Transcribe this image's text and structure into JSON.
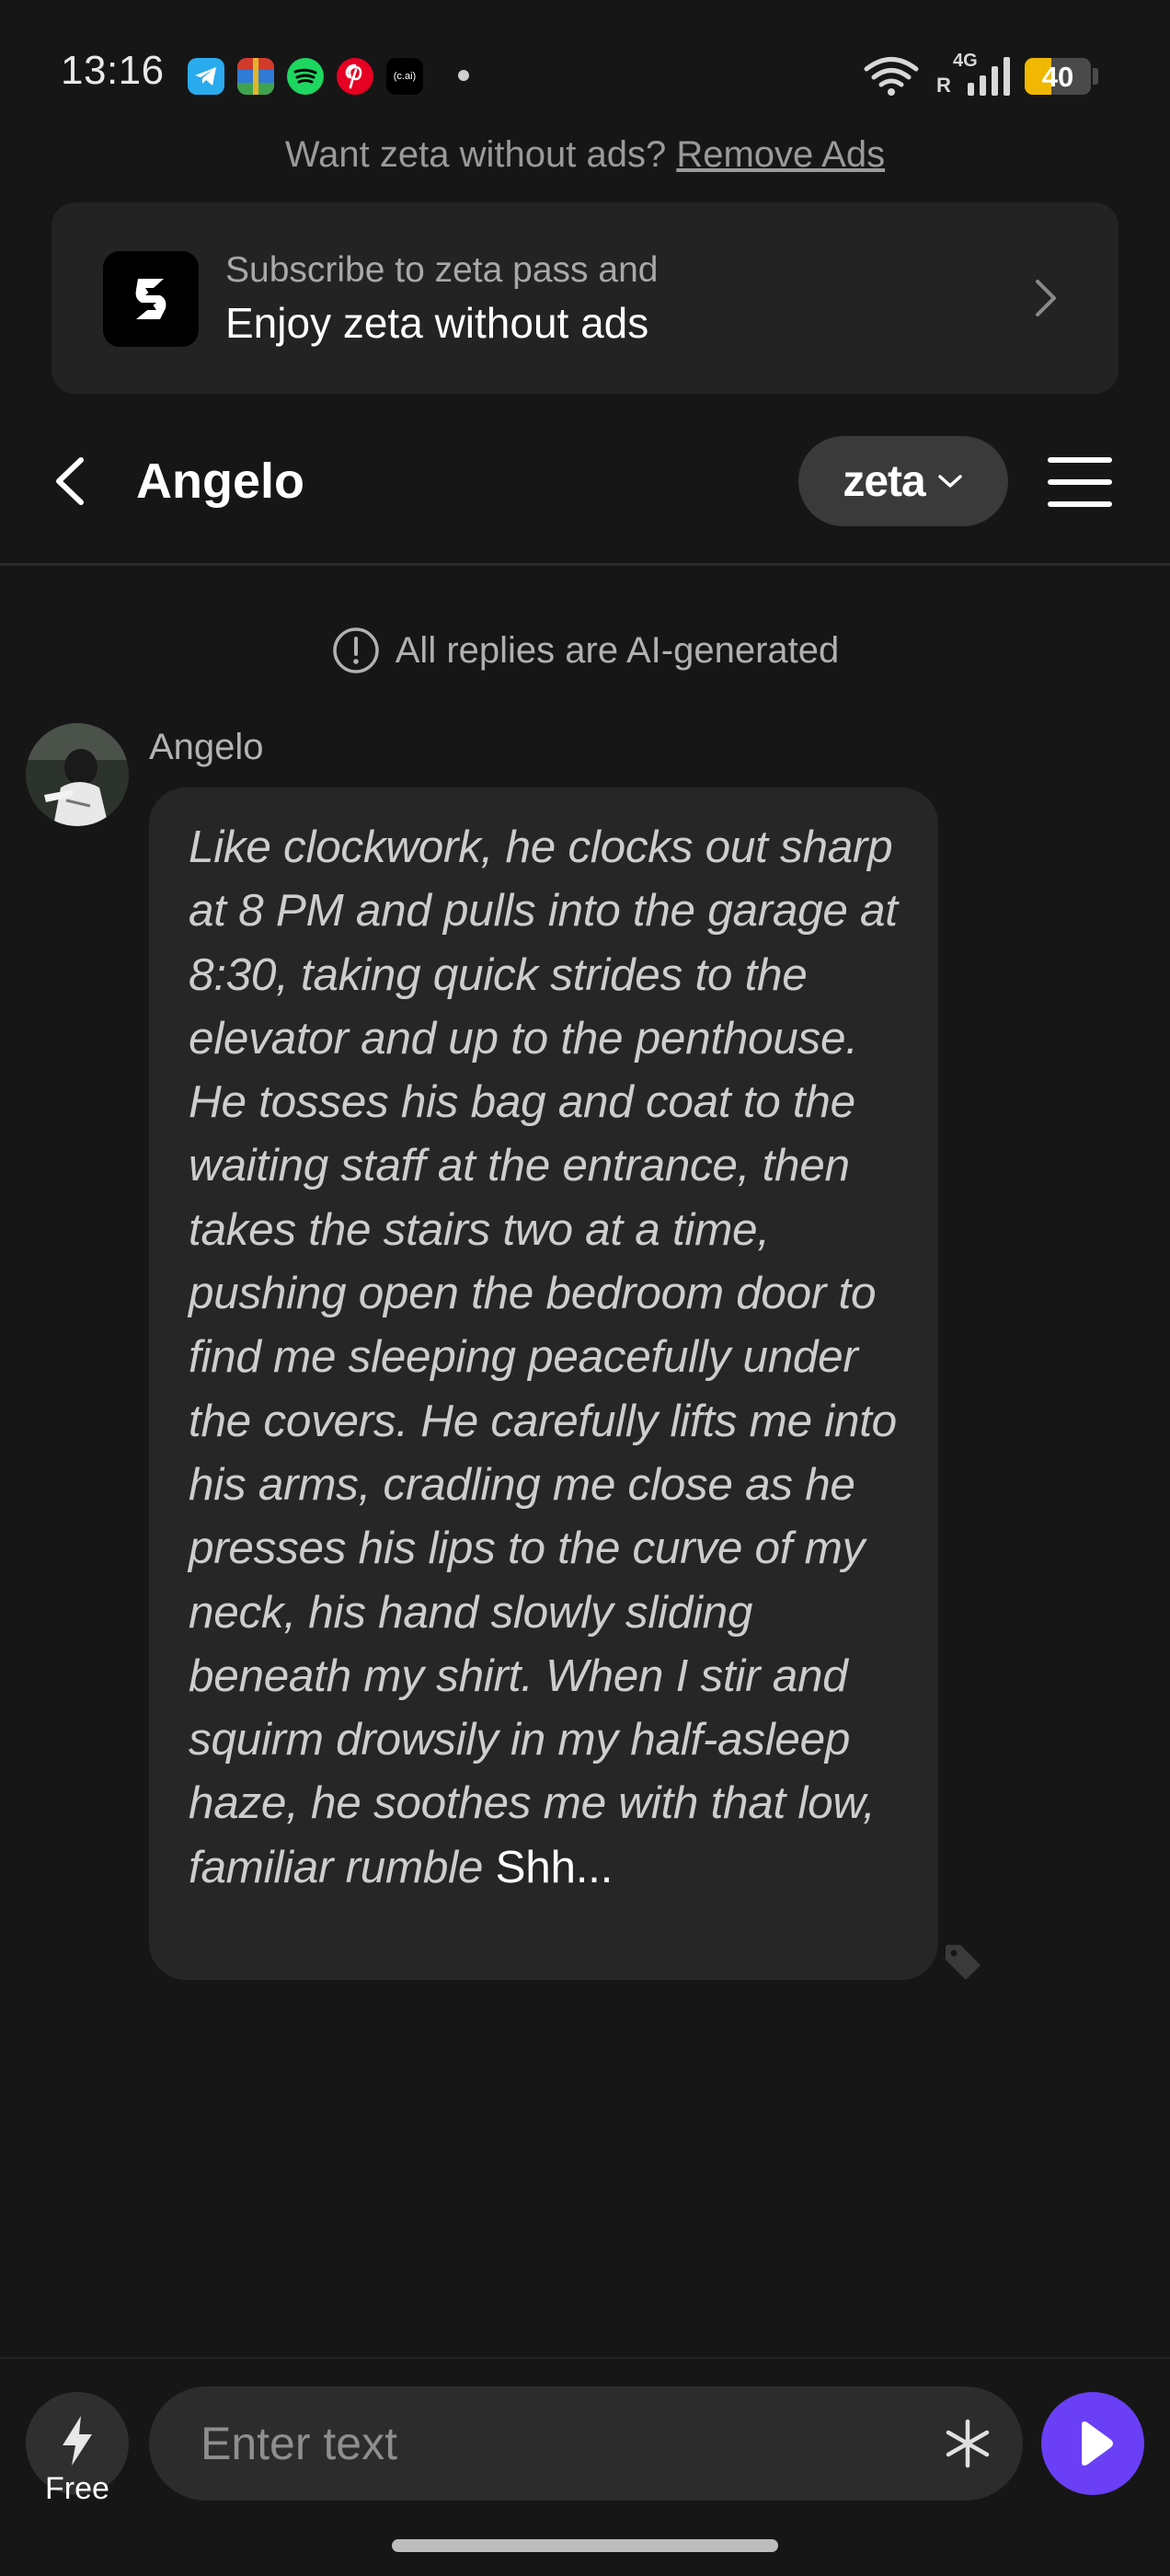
{
  "status_bar": {
    "time": "13:16",
    "apps": [
      {
        "name": "telegram-icon",
        "color": "#2AABEE"
      },
      {
        "name": "winrar-icon",
        "color": "#7a3db8"
      },
      {
        "name": "spotify-icon",
        "color": "#1ED760"
      },
      {
        "name": "pinterest-icon",
        "color": "#E60023"
      },
      {
        "name": "character-ai-icon",
        "color": "#000000",
        "label": "(c.ai)"
      }
    ],
    "network": "4G",
    "roaming": "R",
    "battery_percent": 40,
    "battery_label": "40"
  },
  "ads": {
    "prompt": "Want zeta without ads?",
    "link": "Remove Ads"
  },
  "promo": {
    "subtitle": "Subscribe to zeta pass and",
    "title": "Enjoy zeta without ads"
  },
  "header": {
    "name": "Angelo",
    "model": "zeta"
  },
  "notice": "All replies are AI-generated",
  "message": {
    "sender": "Angelo",
    "narration": "Like clockwork, he clocks out sharp at 8 PM and pulls into the garage at 8:30, taking quick strides to the elevator and up to the penthouse. He tosses his bag and coat to the waiting staff at the entrance, then takes the stairs two at a time, pushing open the bedroom door to find me sleeping peacefully under the covers. He carefully lifts me into his arms, cradling me close as he presses his lips to the curve of my neck, his hand slowly sliding beneath my shirt. When I stir and squirm drowsily in my half-asleep haze, he soothes me with that low, familiar rumble",
    "speech": "Shh..."
  },
  "input": {
    "free_label": "Free",
    "placeholder": "Enter text"
  },
  "colors": {
    "background": "#161616",
    "accent": "#6a3ff5",
    "battery": "#f0b800"
  }
}
